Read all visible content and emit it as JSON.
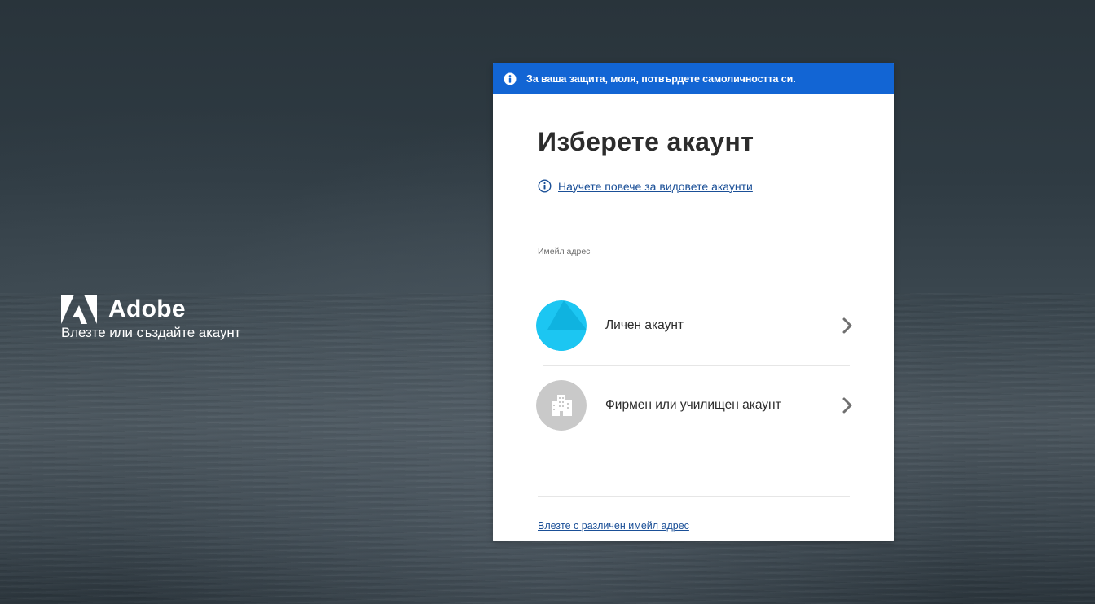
{
  "brand": {
    "name": "Adobe",
    "tagline": "Влезте или създайте акаунт",
    "logo_icon": "adobe-logo-icon"
  },
  "banner": {
    "icon": "info-icon",
    "text": "За ваша защита, моля, потвърдете самоличността си.",
    "color": "#1265d4"
  },
  "card": {
    "title": "Изберете акаунт",
    "learn_more": {
      "icon": "info-outline-icon",
      "text": "Научете повече за видовете акаунти"
    },
    "email_label": "Имейл адрес",
    "accounts": [
      {
        "label": "Личен акаунт",
        "avatar_icon": "personal-avatar-icon",
        "avatar_color": "#16c4f0",
        "chevron_icon": "chevron-right-icon"
      },
      {
        "label": "Фирмен или училищен акаунт",
        "avatar_icon": "building-icon",
        "avatar_color": "#c8c8c8",
        "chevron_icon": "chevron-right-icon"
      }
    ],
    "other_email_link": "Влезте с различен имейл адрес"
  },
  "colors": {
    "link": "#1a4f97",
    "title_text": "#2c2c2c",
    "background_dark": "#2f3b43"
  }
}
